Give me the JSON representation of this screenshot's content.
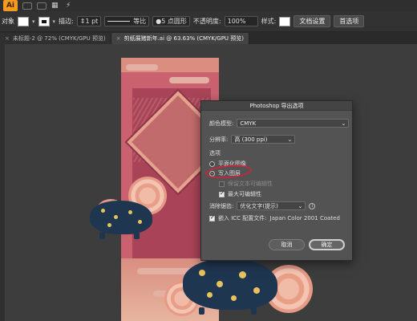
{
  "menubar": {
    "logo": "Ai"
  },
  "control": {
    "left_label": "对象",
    "stroke_label": "描边:",
    "stroke_weight": "1 pt",
    "stroke_profile": "等比",
    "brush": "5 点圆形",
    "opacity_label": "不透明度:",
    "opacity_value": "100%",
    "style_label": "样式:",
    "doc_setup": "文档设置",
    "prefs": "首选项"
  },
  "tabs": [
    {
      "label": "未标题-2 @ 72% (CMYK/GPU 预览)",
      "active": false
    },
    {
      "label": "剪纸展猪新年.ai @ 63.63% (CMYK/GPU 预览)",
      "active": true
    }
  ],
  "dialog": {
    "title": "Photoshop 导出选项",
    "color_model_label": "颜色模型:",
    "color_model_value": "CMYK",
    "resolution_label": "分辨率:",
    "resolution_value": "高 (300 ppi)",
    "options_label": "选项",
    "flat_image": "平面化图像",
    "write_layers": "写入图层",
    "preserve_text": "保留文本可编辑性",
    "max_edit": "最大可编辑性",
    "antialias_label": "消除锯齿:",
    "antialias_value": "优化文字(提示)",
    "embed_icc": "嵌入 ICC 配置文件:",
    "icc_profile": "Japan Color 2001 Coated",
    "cancel": "取消",
    "ok": "确定",
    "write_layers_selected": true,
    "max_edit_checked": true,
    "embed_icc_checked": true
  },
  "colors": {
    "artboard": "#c9616f",
    "pig_navy": "#1f3651",
    "pig_gold": "#e8c25d",
    "annotation_red": "#c2293e"
  }
}
